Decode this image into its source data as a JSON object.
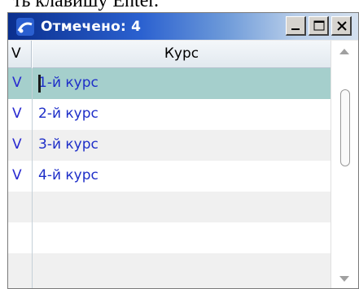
{
  "background_text": "ть клавишу Enter.",
  "window": {
    "title": "Отмечено: 4",
    "buttons": {
      "minimize": "minimize",
      "maximize": "maximize",
      "close": "close"
    }
  },
  "grid": {
    "columns": [
      "V",
      "Курс"
    ],
    "rows": [
      {
        "check": "V",
        "label": "1-й курс",
        "selected": true
      },
      {
        "check": "V",
        "label": "2-й курс",
        "selected": false
      },
      {
        "check": "V",
        "label": "3-й курс",
        "selected": false
      },
      {
        "check": "V",
        "label": "4-й курс",
        "selected": false
      }
    ]
  },
  "colors": {
    "selected_row": "#a5cfcc",
    "text_blue": "#1e2ec8",
    "title_start": "#0a2f8e"
  }
}
